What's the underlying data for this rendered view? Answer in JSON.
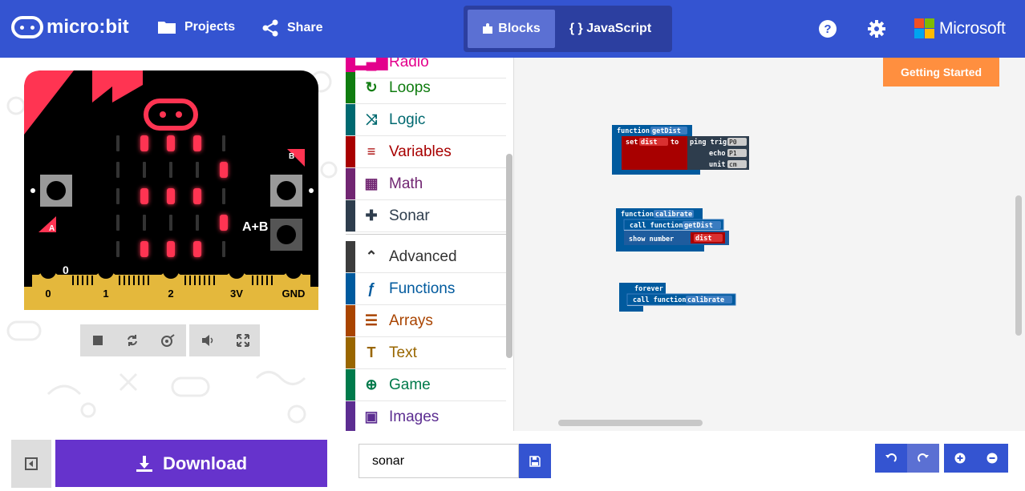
{
  "header": {
    "logo_text": "micro:bit",
    "projects_label": "Projects",
    "share_label": "Share",
    "blocks_label": "Blocks",
    "javascript_label": "{ } JavaScript",
    "microsoft_label": "Microsoft",
    "brand_color": "#3454D1"
  },
  "simulator": {
    "pin_labels": [
      "0",
      "1",
      "2",
      "3V",
      "GND"
    ],
    "pin0_readout": "0",
    "button_a": "A",
    "button_b": "B",
    "button_ab": "A+B",
    "led_grid": [
      [
        0,
        1,
        1,
        1,
        0
      ],
      [
        0,
        0,
        0,
        0,
        1
      ],
      [
        0,
        1,
        1,
        1,
        0
      ],
      [
        0,
        0,
        0,
        0,
        1
      ],
      [
        0,
        1,
        1,
        1,
        0
      ]
    ],
    "controls": [
      "stop-icon",
      "restart-icon",
      "slow-motion-icon",
      "sound-icon",
      "fullscreen-icon"
    ]
  },
  "toolbox": {
    "categories": [
      {
        "label": "Radio",
        "color": "#E3008C",
        "icon": "radio-icon"
      },
      {
        "label": "Loops",
        "color": "#107C10",
        "icon": "loop-icon"
      },
      {
        "label": "Logic",
        "color": "#006970",
        "icon": "shuffle-icon"
      },
      {
        "label": "Variables",
        "color": "#A80000",
        "icon": "list-icon"
      },
      {
        "label": "Math",
        "color": "#712672",
        "icon": "calculator-icon"
      },
      {
        "label": "Sonar",
        "color": "#2E3D4D",
        "icon": "puzzle-icon"
      },
      {
        "label": "Advanced",
        "color": "#3C3C3C",
        "icon": "chevron-up-icon"
      },
      {
        "label": "Functions",
        "color": "#005A9E",
        "icon": "function-icon"
      },
      {
        "label": "Arrays",
        "color": "#A94400",
        "icon": "numbered-list-icon"
      },
      {
        "label": "Text",
        "color": "#996600",
        "icon": "text-icon"
      },
      {
        "label": "Game",
        "color": "#007A4B",
        "icon": "gamepad-icon"
      },
      {
        "label": "Images",
        "color": "#5C2D91",
        "icon": "image-icon"
      }
    ]
  },
  "workspace": {
    "getting_started_label": "Getting Started",
    "blocks": {
      "fn1_kw": "function",
      "fn1_name": "getDist",
      "set_kw": "set",
      "var_dist": "dist",
      "to_kw": "to",
      "ping_trig": "ping trig",
      "trig_val": "P0",
      "echo_kw": "echo",
      "echo_val": "P1",
      "unit_kw": "unit",
      "unit_val": "cm",
      "fn2_kw": "function",
      "fn2_name": "calibrate",
      "call_kw": "call function",
      "call1_name": "getDist",
      "show_number": "show number",
      "forever_kw": "forever",
      "call2_name": "calibrate"
    }
  },
  "bottom": {
    "download_label": "Download",
    "project_name": "sonar"
  }
}
